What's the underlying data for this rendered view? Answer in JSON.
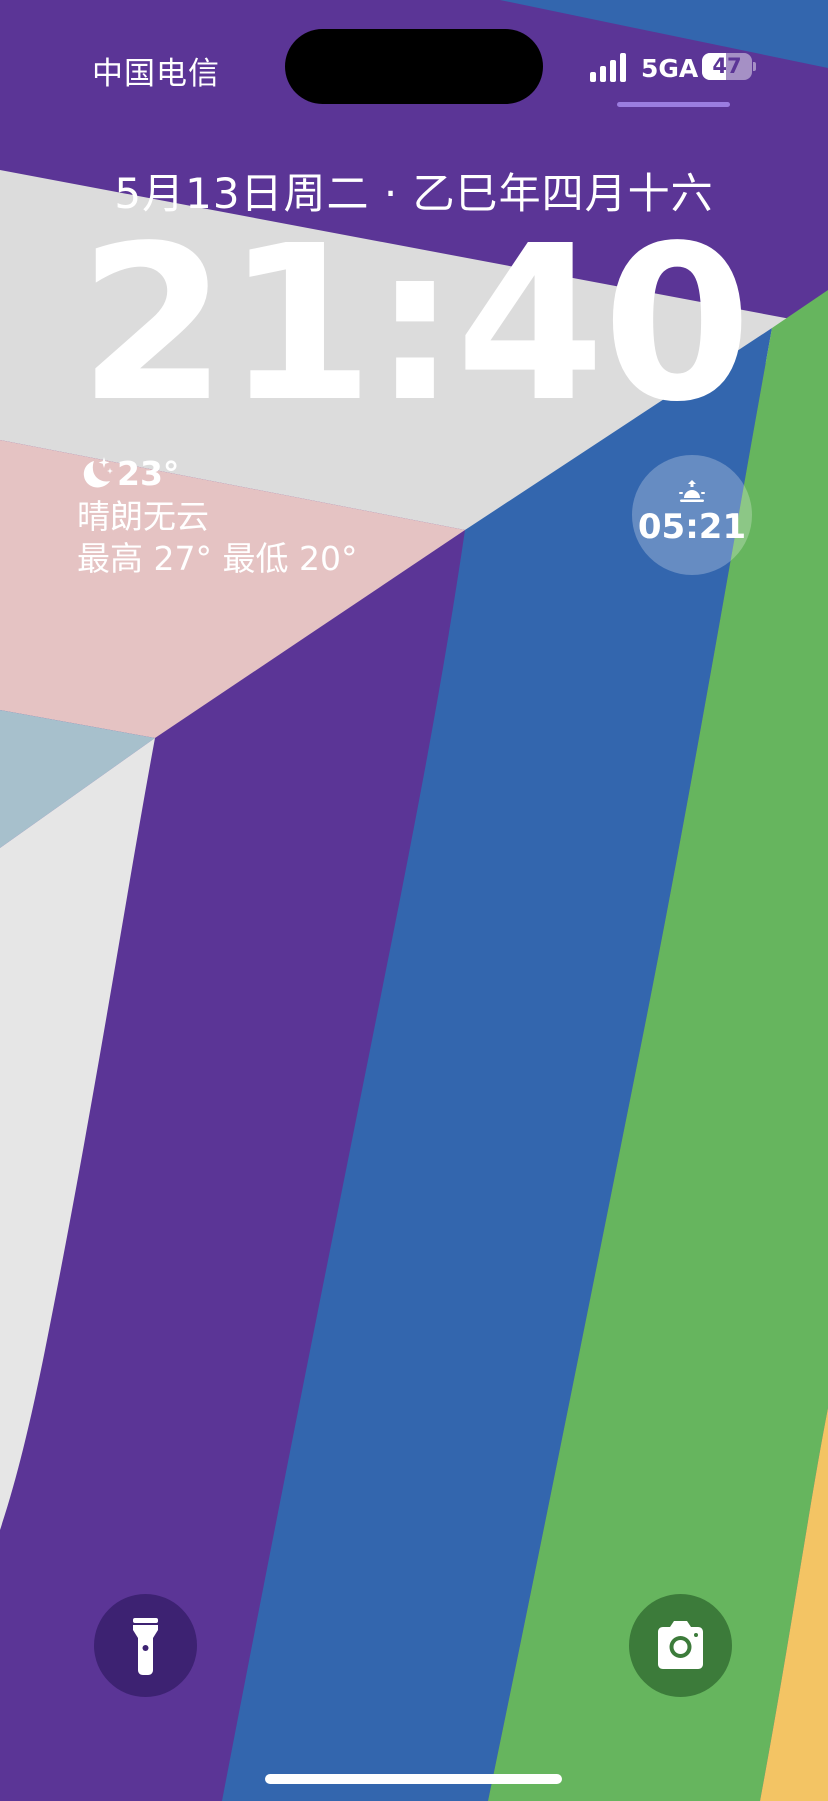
{
  "status_bar": {
    "carrier": "中国电信",
    "network": "5GA",
    "battery_level": "47",
    "battery_fraction": 0.47
  },
  "lock_screen": {
    "date": "5月13日周二 · 乙巳年四月十六",
    "time": "21:40"
  },
  "weather_widget": {
    "icon": "moon-stars-icon",
    "temperature": "23°",
    "condition": "晴朗无云",
    "range": "最高 27° 最低 20°"
  },
  "sunrise_widget": {
    "icon": "sunrise-icon",
    "time": "05:21"
  },
  "quick_actions": {
    "left_icon": "flashlight-icon",
    "right_icon": "camera-icon"
  },
  "colors": {
    "purple": "#5b3596",
    "blue": "#3366ae",
    "green": "#66b55e",
    "yellow": "#f3c464",
    "light_gray": "#dcdcdc",
    "pink": "#e5c3c3",
    "light_blue": "#a7c0cc"
  }
}
